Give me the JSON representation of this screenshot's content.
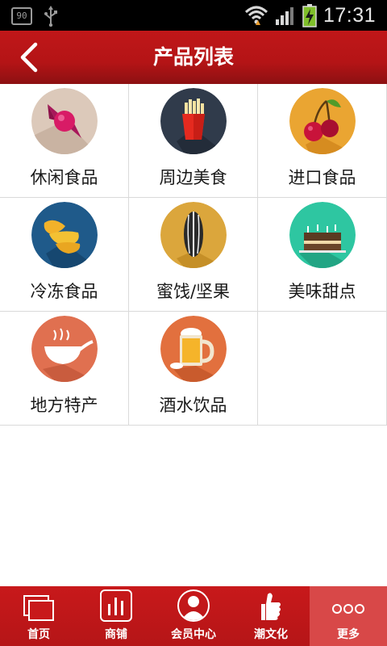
{
  "status_bar": {
    "notification_badge": "90",
    "time": "17:31"
  },
  "header": {
    "title": "产品列表"
  },
  "categories": [
    {
      "label": "休闲食品",
      "icon": "candy-icon",
      "color": "#d9c7b8"
    },
    {
      "label": "周边美食",
      "icon": "french-fries-icon",
      "color": "#2f3a4a"
    },
    {
      "label": "进口食品",
      "icon": "cherry-icon",
      "color": "#e9a631"
    },
    {
      "label": "冷冻食品",
      "icon": "chicken-wings-icon",
      "color": "#1f5a8a"
    },
    {
      "label": "蜜饯/坚果",
      "icon": "sunflower-seed-icon",
      "color": "#d9a43b"
    },
    {
      "label": "美味甜点",
      "icon": "cake-icon",
      "color": "#2fc7a2"
    },
    {
      "label": "地方特产",
      "icon": "soup-bowl-icon",
      "color": "#e07050"
    },
    {
      "label": "酒水饮品",
      "icon": "beer-mug-icon",
      "color": "#e2703e"
    }
  ],
  "tab_bar": {
    "items": [
      {
        "label": "首页",
        "icon": "home-pages-icon"
      },
      {
        "label": "商铺",
        "icon": "shop-icon"
      },
      {
        "label": "会员中心",
        "icon": "member-icon"
      },
      {
        "label": "潮文化",
        "icon": "thumbs-up-icon"
      },
      {
        "label": "更多",
        "icon": "more-icon"
      }
    ],
    "active_index": 4
  },
  "colors": {
    "brand_red": "#c01719",
    "active_tab": "#d84848",
    "grid_border": "#dadada"
  }
}
